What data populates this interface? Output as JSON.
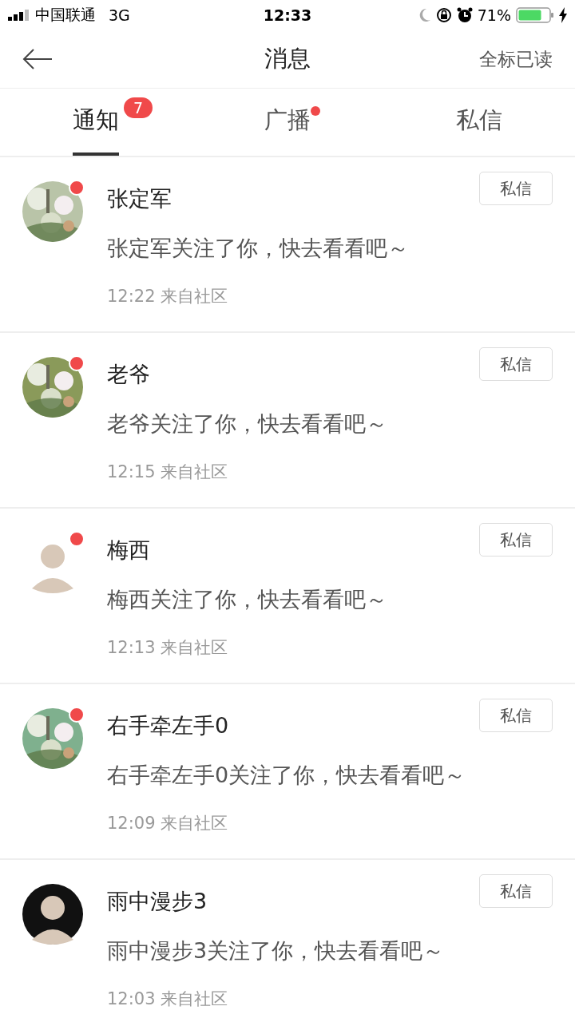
{
  "status_bar": {
    "carrier": "中国联通",
    "network": "3G",
    "time": "12:33",
    "battery": "71%"
  },
  "header": {
    "title": "消息",
    "action": "全标已读"
  },
  "tabs": [
    {
      "label": "通知",
      "selected": true,
      "badge": "7",
      "dot": false
    },
    {
      "label": "广播",
      "selected": false,
      "dot": true
    },
    {
      "label": "私信",
      "selected": false,
      "dot": false
    }
  ],
  "messages": [
    {
      "name": "张定军",
      "text": "张定军关注了你，快去看看吧～",
      "time": "12:22",
      "source": "来自社区",
      "unread": true,
      "button": "私信"
    },
    {
      "name": "老爷",
      "text": "老爷关注了你，快去看看吧～",
      "time": "12:15",
      "source": "来自社区",
      "unread": true,
      "button": "私信"
    },
    {
      "name": "梅西",
      "text": "梅西关注了你，快去看看吧～",
      "time": "12:13",
      "source": "来自社区",
      "unread": true,
      "button": "私信",
      "avatar": {
        "kind": "silhouette"
      }
    },
    {
      "name": "右手牵左手0",
      "text": "右手牵左手0关注了你，快去看看吧～",
      "time": "12:09",
      "source": "来自社区",
      "unread": true,
      "button": "私信"
    },
    {
      "name": "雨中漫步3",
      "text": "雨中漫步3关注了你，快去看看吧～",
      "time": "12:03",
      "source": "来自社区",
      "unread": false,
      "button": "私信",
      "avatar": {
        "kind": "silhouette"
      }
    }
  ]
}
